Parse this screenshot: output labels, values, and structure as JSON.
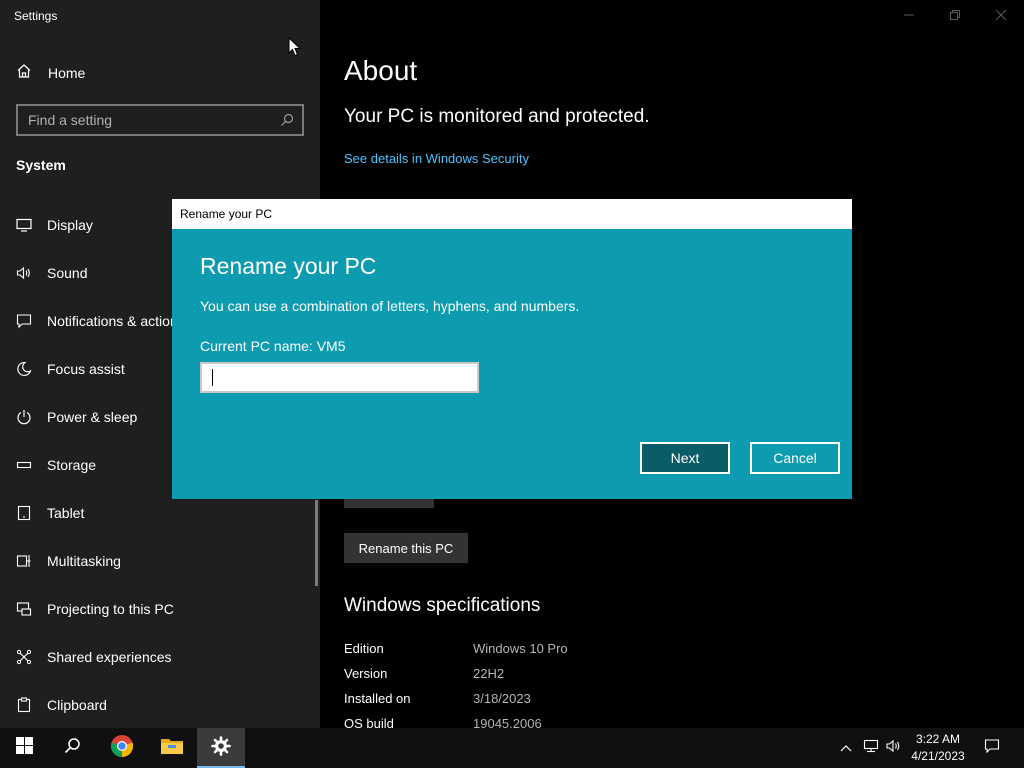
{
  "app": {
    "title": "Settings"
  },
  "sidebar": {
    "home_label": "Home",
    "search_placeholder": "Find a setting",
    "section_title": "System",
    "items": [
      {
        "label": "Display",
        "icon": "monitor-icon"
      },
      {
        "label": "Sound",
        "icon": "speaker-icon"
      },
      {
        "label": "Notifications & actions",
        "icon": "notification-icon"
      },
      {
        "label": "Focus assist",
        "icon": "moon-icon"
      },
      {
        "label": "Power & sleep",
        "icon": "power-icon"
      },
      {
        "label": "Storage",
        "icon": "storage-icon"
      },
      {
        "label": "Tablet",
        "icon": "tablet-icon"
      },
      {
        "label": "Multitasking",
        "icon": "multitasking-icon"
      },
      {
        "label": "Projecting to this PC",
        "icon": "projecting-icon"
      },
      {
        "label": "Shared experiences",
        "icon": "shared-icon"
      },
      {
        "label": "Clipboard",
        "icon": "clipboard-icon"
      }
    ]
  },
  "main": {
    "title": "About",
    "protection_status": "Your PC is monitored and protected.",
    "security_link": "See details in Windows Security",
    "rename_button": "Rename this PC",
    "specs_title": "Windows specifications",
    "specs": [
      {
        "key": "Edition",
        "value": "Windows 10 Pro"
      },
      {
        "key": "Version",
        "value": "22H2"
      },
      {
        "key": "Installed on",
        "value": "3/18/2023"
      },
      {
        "key": "OS build",
        "value": "19045.2006"
      }
    ]
  },
  "dialog": {
    "window_title": "Rename your PC",
    "heading": "Rename your PC",
    "description": "You can use a combination of letters, hyphens, and numbers.",
    "current_name": "Current PC name: VM5",
    "input_value": "",
    "next_label": "Next",
    "cancel_label": "Cancel"
  },
  "taskbar": {
    "time": "3:22 AM",
    "date": "4/21/2023",
    "apps": [
      "start-icon",
      "search-icon",
      "chrome-icon",
      "file-explorer-icon",
      "settings-icon"
    ]
  },
  "colors": {
    "sidebar_bg": "#1f1f1f",
    "dialog_bg": "#0d9bb0",
    "link": "#4cc2ff",
    "next_button": "#0a5d66"
  }
}
